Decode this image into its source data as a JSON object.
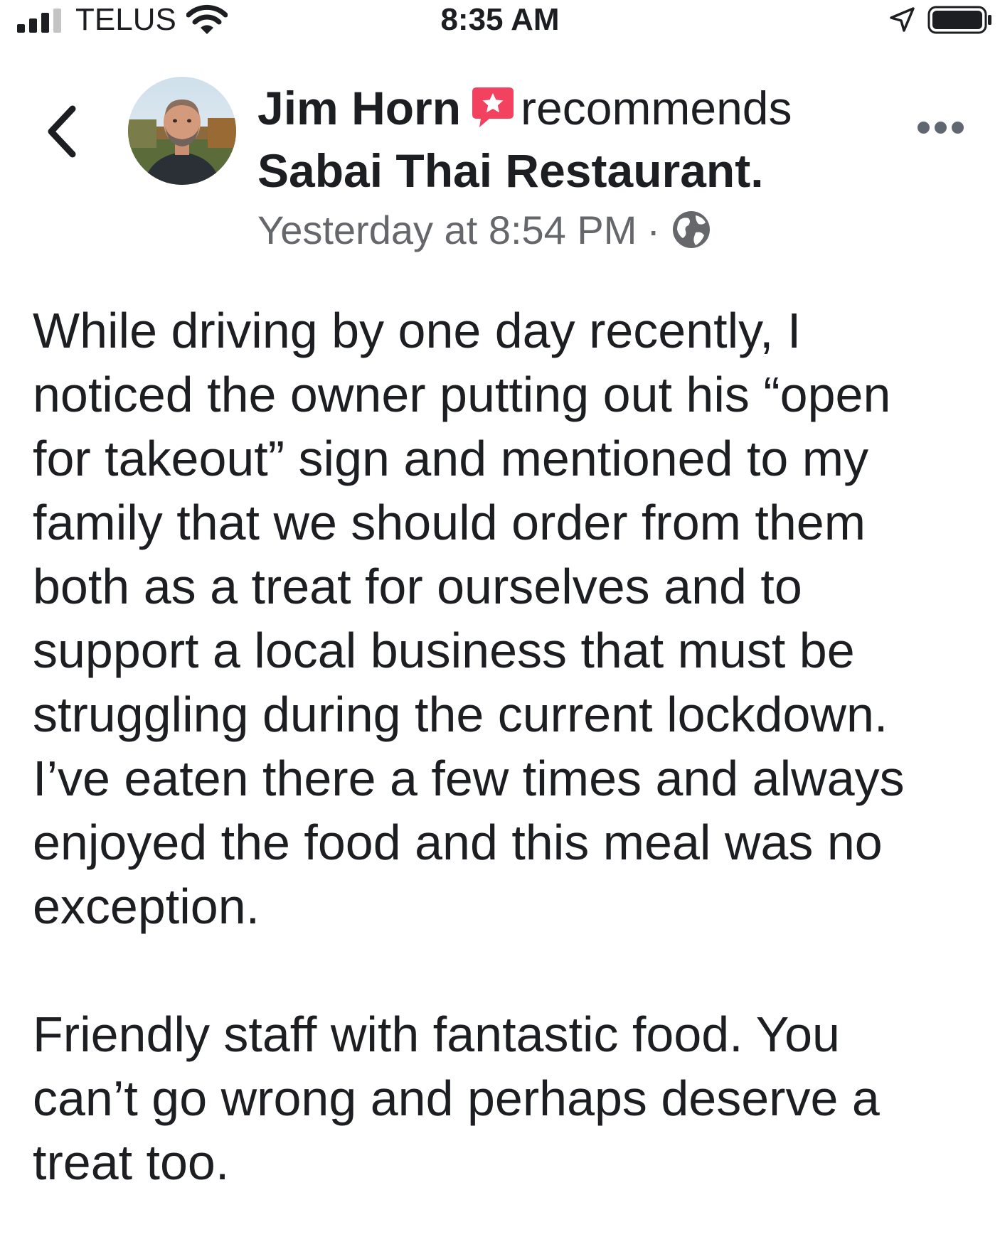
{
  "status_bar": {
    "carrier": "TELUS",
    "time": "8:35 AM",
    "signal_bars_filled": 3,
    "signal_bars_total": 4,
    "battery_level": 1.0,
    "icons": [
      "signal-bars-icon",
      "wifi-icon",
      "location-arrow-icon",
      "battery-icon"
    ]
  },
  "post": {
    "author": "Jim Horn",
    "action": "recommends",
    "page": "Sabai Thai Restaurant.",
    "timestamp": "Yesterday at 8:54 PM",
    "separator": "·",
    "audience_icon": "globe-icon",
    "recommendation_icon": "recommendation-star-badge-icon",
    "badge_color": "#f3425f",
    "body_lines": [
      "While driving by one day recently, I",
      "noticed the owner putting out his “open",
      "for takeout” sign and mentioned to my",
      "family that we should order from them",
      "both as a treat for ourselves and to",
      "support a local business that must be",
      "struggling during the current lockdown.",
      "I’ve eaten there a few times and always",
      "enjoyed the food and this meal was no",
      "exception."
    ],
    "body_lines_2": [
      "Friendly staff with fantastic food. You",
      "can’t go wrong and perhaps deserve a",
      "treat too."
    ]
  },
  "header_icons": {
    "back": "back-chevron-icon",
    "more": "more-options-icon"
  },
  "colors": {
    "text_primary": "#1c1e21",
    "text_secondary": "#65676b",
    "background": "#ffffff"
  }
}
